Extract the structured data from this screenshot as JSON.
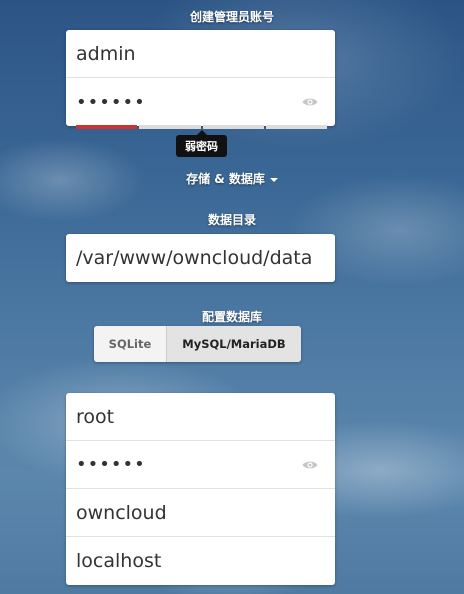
{
  "admin": {
    "heading": "创建管理员账号",
    "username": "admin",
    "password_mask": "••••••",
    "strength_tooltip": "弱密码",
    "strength_level": 0.25
  },
  "storage": {
    "toggle_label": "存储 & 数据库"
  },
  "data_dir": {
    "heading": "数据目录",
    "path": "/var/www/owncloud/data"
  },
  "database": {
    "heading": "配置数据库",
    "options": [
      "SQLite",
      "MySQL/MariaDB"
    ],
    "selected": "MySQL/MariaDB",
    "user": "root",
    "password_mask": "••••••",
    "name": "owncloud",
    "host": "localhost"
  },
  "icons": {
    "show_password": "eye-icon",
    "dropdown": "caret-down-icon"
  },
  "colors": {
    "weak_strength": "#cc3333",
    "tooltip_bg": "#111111"
  }
}
